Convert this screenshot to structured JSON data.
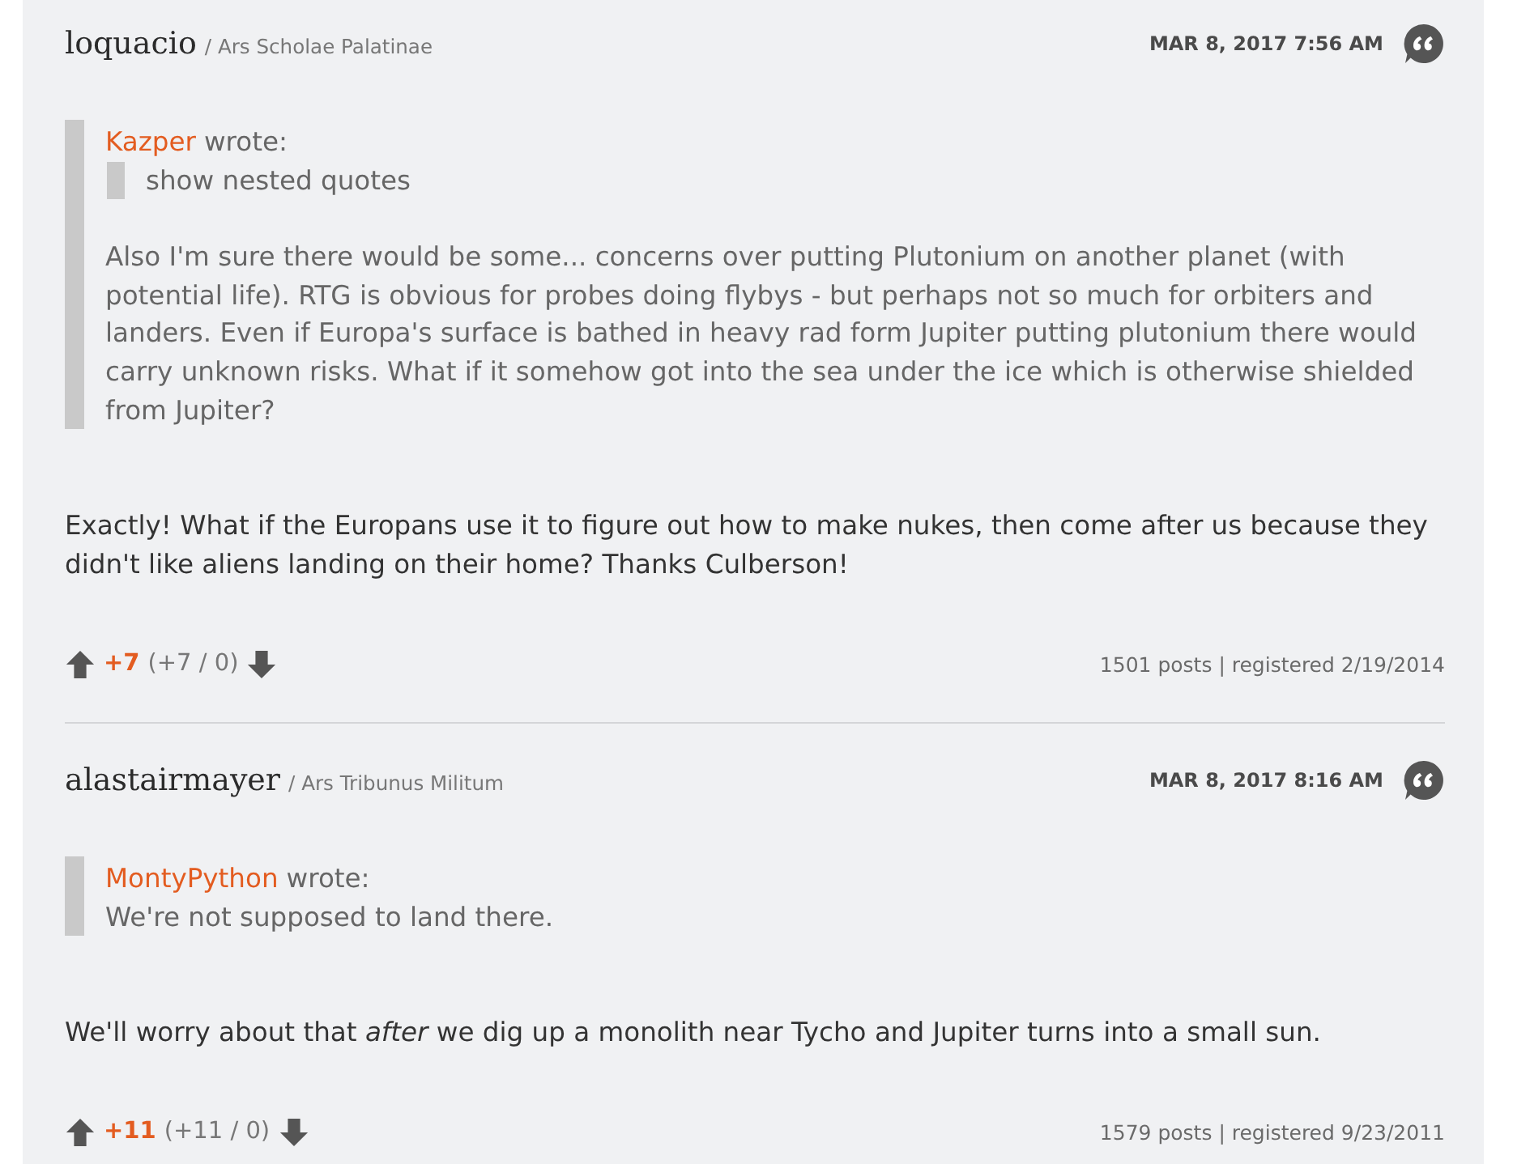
{
  "posts": [
    {
      "author": "loquacio",
      "rank": "/ Ars Scholae Palatinae",
      "date": "MAR 8, 2017 7:56 AM",
      "quote": {
        "author": "Kazper",
        "wrote": "wrote:",
        "nested_toggle": "show nested quotes",
        "text": "Also I'm sure there would be some... concerns over putting Plutonium on another planet (with potential life). RTG is obvious for probes doing flybys - but perhaps not so much for orbiters and landers. Even if Europa's surface is bathed in heavy rad form Jupiter putting plutonium there would carry unknown risks. What if it somehow got into the sea under the ice which is otherwise shielded from Jupiter?"
      },
      "body": "Exactly! What if the Europans use it to figure out how to make nukes, then come after us because they didn't like aliens landing on their home? Thanks Culberson!",
      "score": "+7",
      "votes": "(+7 / 0)",
      "stats": "1501 posts | registered 2/19/2014"
    },
    {
      "author": "alastairmayer",
      "rank": "/ Ars Tribunus Militum",
      "date": "MAR 8, 2017 8:16 AM",
      "quote": {
        "author": "MontyPython",
        "wrote": "wrote:",
        "text": "We're not supposed to land there."
      },
      "body": "We'll worry about that *after* we dig up a monolith near Tycho and Jupiter turns into a small sun.",
      "score": "+11",
      "votes": "(+11 / 0)",
      "stats": "1579 posts | registered 9/23/2011"
    }
  ]
}
